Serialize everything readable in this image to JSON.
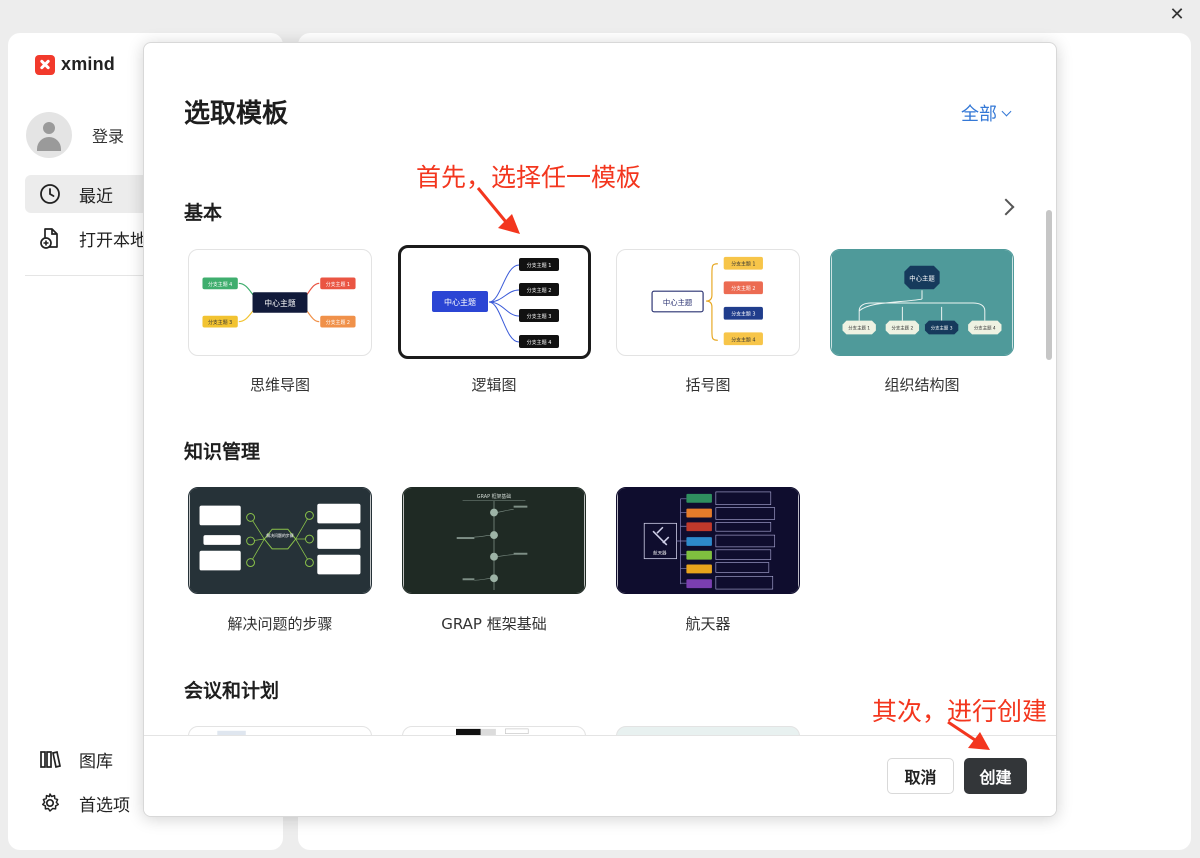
{
  "window": {
    "close_glyph": "✕"
  },
  "app": {
    "logo_text": "xmind",
    "user": {
      "label": "登录"
    },
    "nav": [
      {
        "label": "最近",
        "icon": "clock-icon",
        "active": true
      },
      {
        "label": "打开本地",
        "icon": "file-add-icon"
      }
    ],
    "bottom_nav": [
      {
        "label": "图库",
        "icon": "library-icon"
      },
      {
        "label": "首选项",
        "icon": "gear-icon"
      }
    ]
  },
  "dialog": {
    "title": "选取模板",
    "filter_label": "全部",
    "sections": [
      {
        "title": "基本",
        "templates": [
          {
            "label": "思维导图",
            "selected": false
          },
          {
            "label": "逻辑图",
            "selected": true
          },
          {
            "label": "括号图",
            "selected": false
          },
          {
            "label": "组织结构图",
            "selected": false
          }
        ]
      },
      {
        "title": "知识管理",
        "templates": [
          {
            "label": "解决问题的步骤"
          },
          {
            "label": "GRAP 框架基础"
          },
          {
            "label": "航天器"
          }
        ]
      },
      {
        "title": "会议和计划",
        "templates": []
      }
    ],
    "thumb_text": {
      "central": "中心主题",
      "branch1": "分支主题 1",
      "branch2": "分支主题 2",
      "branch3": "分支主题 3",
      "branch4": "分支主题 4",
      "problem_center": "解决问题的步骤",
      "grap_title": "GRAP 框架基础",
      "spacecraft": "航天器"
    },
    "buttons": {
      "cancel": "取消",
      "create": "创建"
    }
  },
  "annotations": {
    "first": "首先，选择任一模板",
    "second": "其次，进行创建"
  },
  "colors": {
    "accent_blue": "#3478d6",
    "annotation_red": "#f3361e",
    "create_button": "#333639",
    "org_bg": "#4f9a9a",
    "dark_card": "#263238"
  }
}
